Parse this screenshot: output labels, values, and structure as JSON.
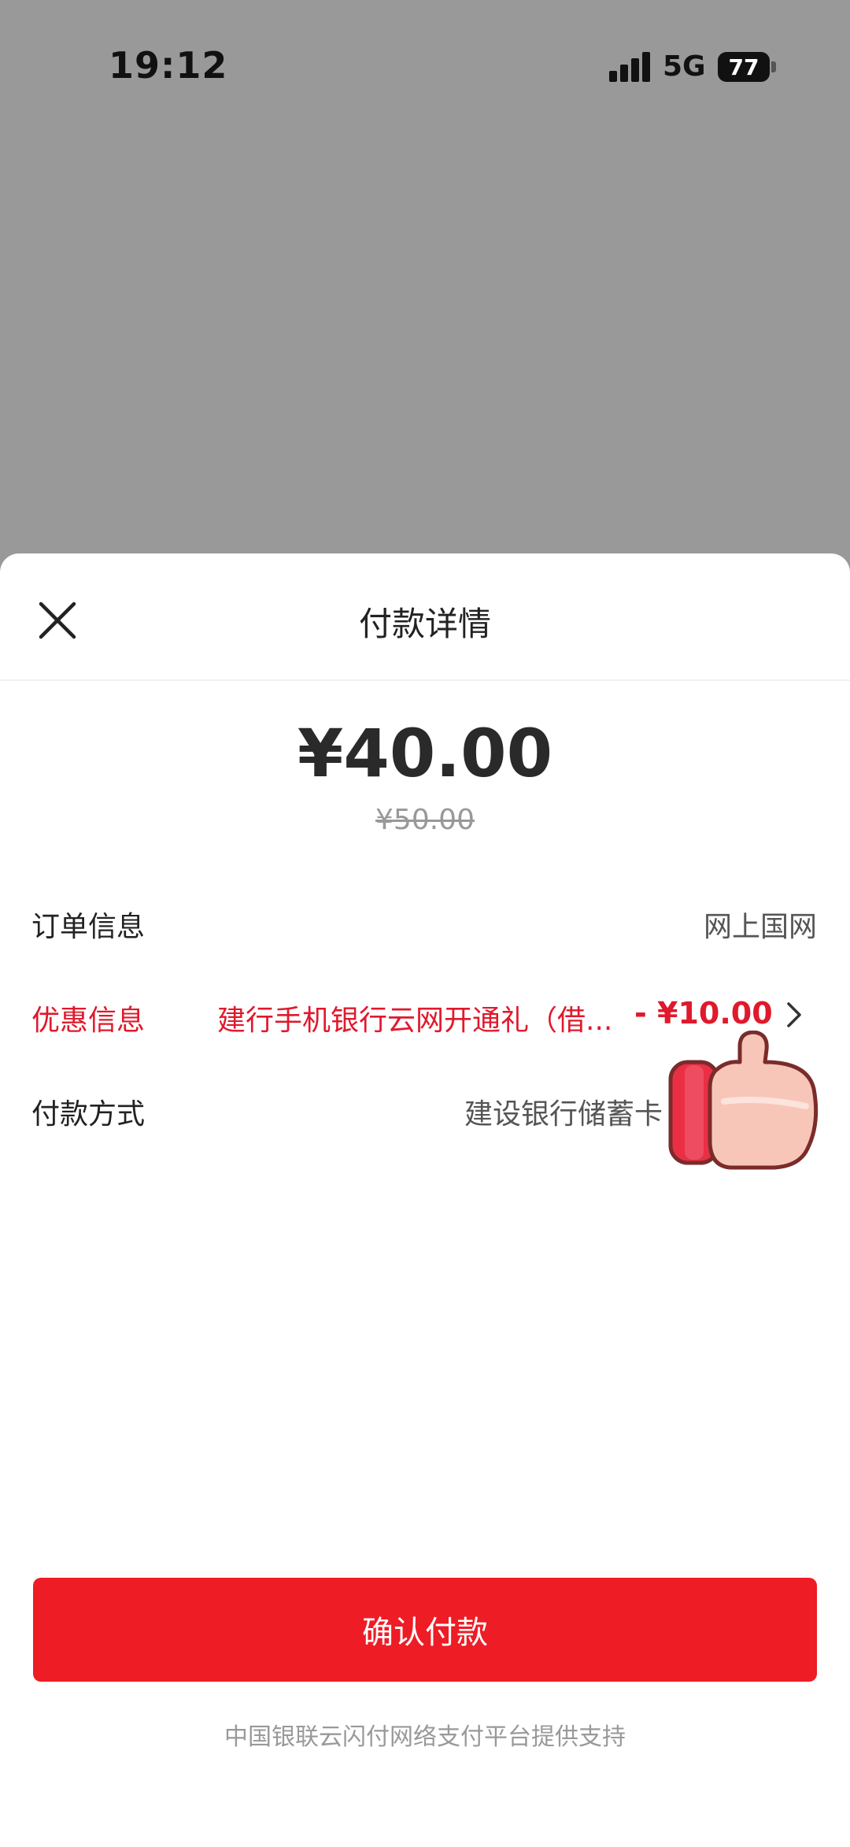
{
  "status_bar": {
    "time": "19:12",
    "network": "5G",
    "battery": "77"
  },
  "sheet": {
    "title": "付款详情",
    "amount": "¥40.00",
    "original_amount": "¥50.00",
    "rows": {
      "order": {
        "label": "订单信息",
        "value": "网上国网"
      },
      "promo": {
        "label": "优惠信息",
        "value": "建行手机银行云网开通礼（借...",
        "discount": "- ¥10.00"
      },
      "payment": {
        "label": "付款方式",
        "value": "建设银行储蓄卡"
      }
    },
    "confirm_label": "确认付款",
    "footer_note": "中国银联云闪付网络支付平台提供支持"
  },
  "colors": {
    "overlay": "#999999",
    "accent": "#ee1c25",
    "promo_text": "#e0192c"
  },
  "icons": [
    "close-icon",
    "chevron-right-icon",
    "thumbs-up-sticker"
  ]
}
